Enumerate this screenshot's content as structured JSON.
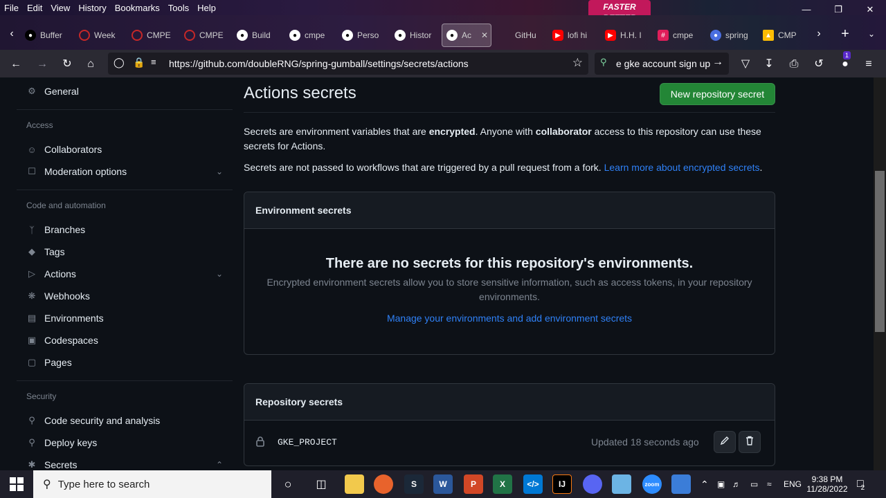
{
  "menu": [
    "File",
    "Edit",
    "View",
    "History",
    "Bookmarks",
    "Tools",
    "Help"
  ],
  "banner_text": "FASTER BETTER",
  "tabs": [
    {
      "label": "Buffer",
      "icon": "medium-icon",
      "color": "#000000"
    },
    {
      "label": "Week",
      "icon": "circle-icon",
      "color": "#c62828"
    },
    {
      "label": "CMPE",
      "icon": "circle-icon",
      "color": "#c62828"
    },
    {
      "label": "CMPE",
      "icon": "circle-icon",
      "color": "#c62828"
    },
    {
      "label": "Build",
      "icon": "github-icon",
      "color": "#ffffff"
    },
    {
      "label": "cmpe",
      "icon": "github-icon",
      "color": "#ffffff"
    },
    {
      "label": "Perso",
      "icon": "github-icon",
      "color": "#ffffff"
    },
    {
      "label": "Histor",
      "icon": "github-icon",
      "color": "#ffffff"
    },
    {
      "label": "Ac",
      "icon": "github-icon",
      "color": "#ffffff",
      "active": true
    },
    {
      "label": "GitHu",
      "icon": "github-icon",
      "color": "#ffffff"
    },
    {
      "label": "lofi hi",
      "icon": "youtube-icon",
      "color": "#ff0000"
    },
    {
      "label": "H.H. I",
      "icon": "youtube-icon",
      "color": "#ff0000"
    },
    {
      "label": "cmpe",
      "icon": "slack-icon",
      "color": "#e01e5a"
    },
    {
      "label": "spring",
      "icon": "spring-icon",
      "color": "#4a6ee0"
    },
    {
      "label": "CMP",
      "icon": "drive-icon",
      "color": "#fbbc04"
    }
  ],
  "url": "https://github.com/doubleRNG/spring-gumball/settings/secrets/actions",
  "search_text": "e gke account sign up",
  "notif_count": "1",
  "sidebar": {
    "general": "General",
    "access_heading": "Access",
    "collaborators": "Collaborators",
    "moderation": "Moderation options",
    "code_heading": "Code and automation",
    "branches": "Branches",
    "tags": "Tags",
    "actions": "Actions",
    "webhooks": "Webhooks",
    "environments": "Environments",
    "codespaces": "Codespaces",
    "pages": "Pages",
    "security_heading": "Security",
    "code_security": "Code security and analysis",
    "deploy_keys": "Deploy keys",
    "secrets": "Secrets"
  },
  "main": {
    "title": "Actions secrets",
    "new_button": "New repository secret",
    "desc1_a": "Secrets are environment variables that are ",
    "desc1_b": "encrypted",
    "desc1_c": ". Anyone with ",
    "desc1_d": "collaborator",
    "desc1_e": " access to this repository can use these secrets for Actions.",
    "desc2": "Secrets are not passed to workflows that are triggered by a pull request from a fork. ",
    "desc2_link": "Learn more about encrypted secrets",
    "desc2_end": ".",
    "env_header": "Environment secrets",
    "env_empty_title": "There are no secrets for this repository's environments.",
    "env_empty_desc": "Encrypted environment secrets allow you to store sensitive information, such as access tokens, in your repository environments.",
    "env_link": "Manage your environments and add environment secrets",
    "repo_header": "Repository secrets",
    "secret_name": "GKE_PROJECT",
    "secret_updated": "Updated 18 seconds ago"
  },
  "taskbar": {
    "search_placeholder": "Type here to search",
    "lang": "ENG",
    "time": "9:38 PM",
    "date": "11/28/2022",
    "notif": "2"
  },
  "colors": {
    "accent": "#2f81f7",
    "primary_button": "#238636",
    "bg": "#0d1117"
  }
}
